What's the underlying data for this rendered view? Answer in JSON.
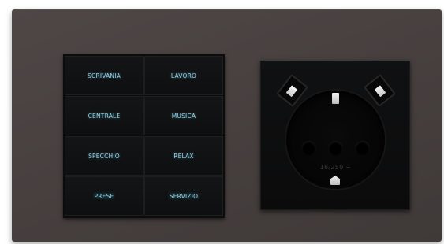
{
  "keypad": {
    "keys": [
      {
        "label": "SCRIVANIA"
      },
      {
        "label": "LAVORO"
      },
      {
        "label": "CENTRALE"
      },
      {
        "label": "MUSICA"
      },
      {
        "label": "SPECCHIO"
      },
      {
        "label": "RELAX"
      },
      {
        "label": "PRESE"
      },
      {
        "label": "SERVIZIO"
      }
    ]
  },
  "socket": {
    "rating_text": "16/250 ~"
  },
  "colors": {
    "frame": "#4a4342",
    "keypad": "#0c0c0c",
    "key_text": "#8fd3e6",
    "socket": "#0d0e0f"
  }
}
